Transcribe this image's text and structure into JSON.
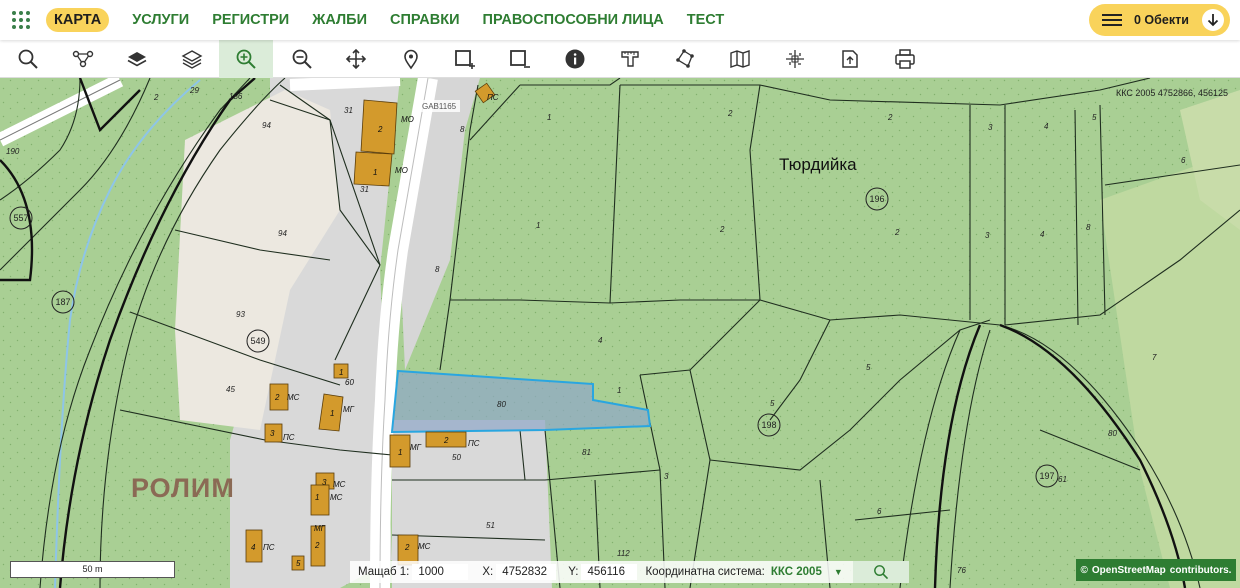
{
  "nav": {
    "items": [
      {
        "label": "КАРТА",
        "active": true
      },
      {
        "label": "УСЛУГИ"
      },
      {
        "label": "РЕГИСТРИ"
      },
      {
        "label": "ЖАЛБИ"
      },
      {
        "label": "СПРАВКИ"
      },
      {
        "label": "ПРАВОСПОСОБНИ ЛИЦА"
      },
      {
        "label": "ТЕСТ"
      }
    ],
    "objects_label": "0 Обекти"
  },
  "toolbar": {
    "tools": [
      "search-icon",
      "route-icon",
      "layers-icon",
      "layers-stack-icon",
      "zoom-in-icon",
      "zoom-out-icon",
      "pan-icon",
      "pin-icon",
      "select-add-icon",
      "select-remove-icon",
      "info-icon",
      "measure-icon",
      "polygon-icon",
      "map-icon",
      "crosshair-icon",
      "export-icon",
      "print-icon"
    ],
    "active_tool": "zoom-in-icon"
  },
  "map": {
    "coord_label": "ККС 2005 4752866, 456125",
    "place_labels": [
      "Тюрдийка",
      "РОЛИМ"
    ],
    "road_label": "GAB1165",
    "circled_labels": [
      "557",
      "187",
      "549",
      "196",
      "198",
      "197"
    ],
    "parcel_numbers": [
      "2",
      "29",
      "186",
      "190",
      "94",
      "31",
      "8",
      "2",
      "1",
      "1",
      "2",
      "3",
      "4",
      "5",
      "6",
      "2",
      "1",
      "2",
      "2",
      "3",
      "4",
      "3",
      "4",
      "8",
      "93",
      "45",
      "80",
      "1",
      "4",
      "5",
      "7",
      "81",
      "50",
      "51",
      "112",
      "3",
      "6",
      "80",
      "61",
      "76"
    ],
    "building_labels": [
      "МО",
      "МО",
      "ПС",
      "МС",
      "МГ",
      "ПС",
      "МС",
      "МГ",
      "МС",
      "ПС",
      "МС"
    ],
    "colors": {
      "forest": "#a9cf94",
      "road": "#d9d9d9",
      "building": "#d39a2c",
      "selection": "#5aa4e8"
    }
  },
  "status": {
    "scale_bar_label": "50 m",
    "scale_label": "Мащаб 1:",
    "scale_value": "1000",
    "x_label": "X:",
    "x_value": "4752832",
    "y_label": "Y:",
    "y_value": "456116",
    "system_label": "Координатна система:",
    "system_value": "ККС 2005"
  },
  "attribution": {
    "text": "OpenStreetMap",
    "suffix": "contributors."
  }
}
